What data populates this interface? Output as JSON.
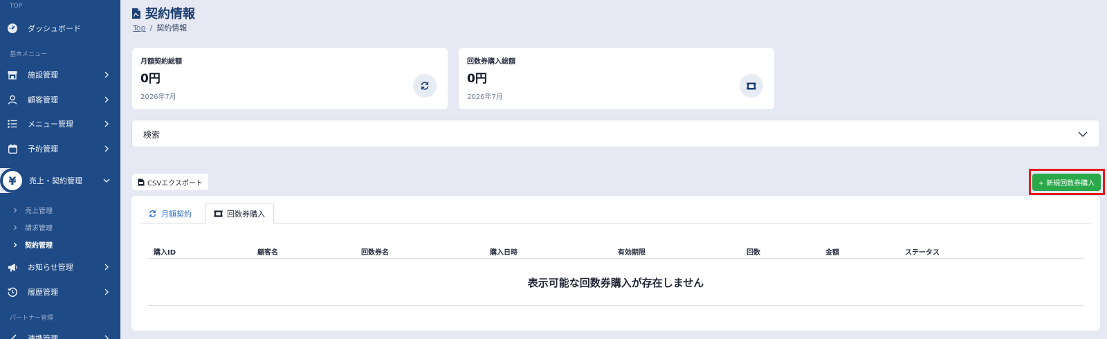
{
  "sidebar": {
    "sections": {
      "top": "TOP",
      "basic": "基本メニュー",
      "partner": "パートナー管理"
    },
    "items": {
      "dashboard": "ダッシュボード",
      "facility": "施設管理",
      "customer": "顧客管理",
      "menu": "メニュー管理",
      "reservation": "予約管理",
      "sales": "売上・契約管理",
      "news": "お知らせ管理",
      "history": "履歴管理",
      "partner_item": "連携管理"
    },
    "sub_items": {
      "sales_mgmt": "売上管理",
      "billing": "請求管理",
      "contract": "契約管理"
    }
  },
  "page": {
    "title": "契約情報"
  },
  "breadcrumb": {
    "top": "Top",
    "sep": "/",
    "current": "契約情報"
  },
  "cards": [
    {
      "label": "月額契約総額",
      "value": "0円",
      "period": "2026年7月",
      "icon": "refresh-icon"
    },
    {
      "label": "回数券購入総額",
      "value": "0円",
      "period": "2026年7月",
      "icon": "ticket-icon"
    }
  ],
  "search": {
    "label": "検索"
  },
  "toolbar": {
    "csv_label": "CSVエクスポート",
    "new_label": "+ 新規回数券購入"
  },
  "tabs": [
    {
      "label": "月額契約",
      "active": false
    },
    {
      "label": "回数券購入",
      "active": true
    }
  ],
  "table": {
    "headers": [
      "購入ID",
      "顧客名",
      "回数券名",
      "購入日時",
      "有効期限",
      "回数",
      "金額",
      "ステータス"
    ],
    "empty_message": "表示可能な回数券購入が存在しません"
  },
  "colors": {
    "sidebar": "#1e4a86",
    "background": "#e6e8f3",
    "accent_green": "#2aa84a",
    "highlight_red": "#e31b1b",
    "tab_blue": "#2f6fd6"
  }
}
